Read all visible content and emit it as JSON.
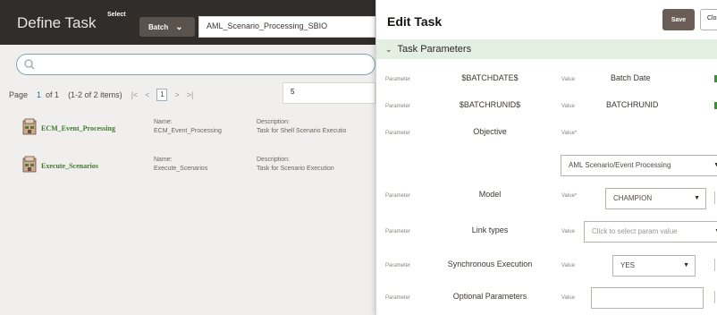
{
  "app": {
    "title": "Define Task"
  },
  "topbar": {
    "select_label": "Select",
    "batch_button": "Batch",
    "batch_value": "AML_Scenario_Processing_SBIO"
  },
  "search": {
    "placeholder": "",
    "value": ""
  },
  "pager": {
    "page_label": "Page",
    "current_page": "1",
    "of_label": "of 1",
    "items_label": "(1-2 of 2 items)",
    "first": "|<",
    "prev": "<",
    "page_input": "1",
    "next": ">",
    "last": ">|",
    "page_size": "5"
  },
  "tasks": [
    {
      "title": "ECM_Event_Processing",
      "name_label": "Name:",
      "name": "ECM_Event_Processing",
      "description_label": "Description:",
      "description": "Task for Shell Scenario Executio"
    },
    {
      "title": "Execute_Scenarios",
      "name_label": "Name:",
      "name": "Execute_Scenarios",
      "description_label": "Description:",
      "description": "Task for Scenario Execution"
    }
  ],
  "drawer": {
    "title": "Edit Task",
    "save": "Save",
    "close": "Clo",
    "section": "Task Parameters",
    "param_label": "Parameter",
    "value_label": "Value",
    "value_required_label": "Value*",
    "params": [
      {
        "name": "$BATCHDATE$",
        "value": "Batch Date"
      },
      {
        "name": "$BATCHRUNID$",
        "value": "BATCHRUNID"
      },
      {
        "name": "Objective",
        "value": "AML Scenario/Event Processing"
      },
      {
        "name": "Model",
        "value": "CHAMPION"
      },
      {
        "name": "Link types",
        "value": "Click to select param value"
      },
      {
        "name": "Synchronous Execution",
        "value": "YES"
      },
      {
        "name": "Optional Parameters",
        "value": ""
      }
    ]
  }
}
